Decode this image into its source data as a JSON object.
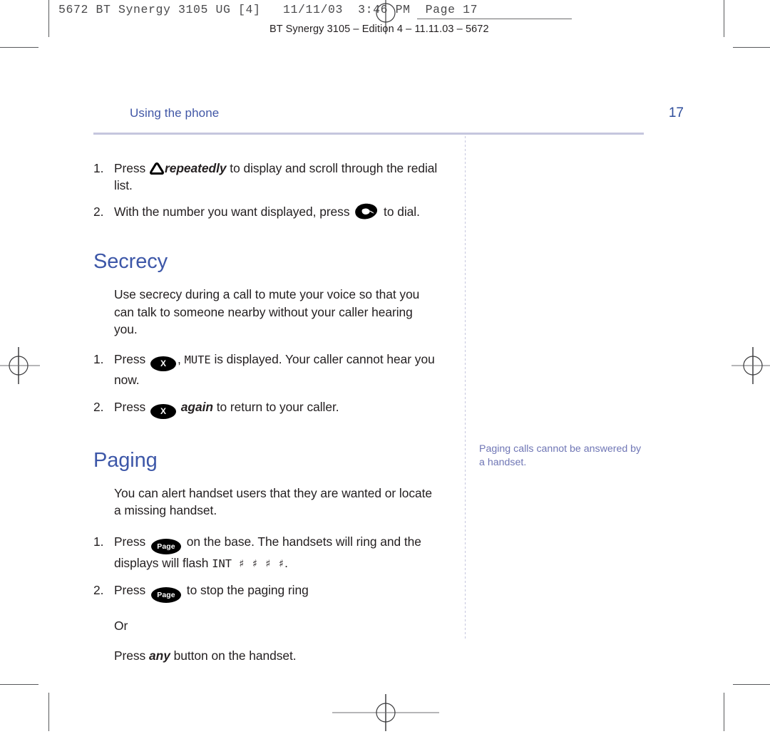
{
  "print_marks": {
    "slug_line": "5672 BT Synergy 3105 UG [4]   11/11/03  3:46 PM  Page 17",
    "registration_mark_name": "registration-mark"
  },
  "running_head": {
    "edition_line": "BT Synergy 3105 – Edition 4 – 11.11.03 – 5672"
  },
  "page_header": {
    "chapter_title": "Using the phone",
    "folio": "17",
    "rule_color": "#c5c6de",
    "title_color": "#4157a6",
    "folio_color": "#2e4d9b"
  },
  "redial_steps": [
    {
      "num": "1.",
      "before_icon": "Press ",
      "icon": "scroll-up-triangle-icon",
      "emphasis": "repeatedly",
      "after": " to display and scroll through the redial list."
    },
    {
      "num": "2.",
      "before_icon": "With the number you want displayed, press ",
      "icon": "dial-handset-icon",
      "after": " to dial."
    }
  ],
  "sections": [
    {
      "heading": "Secrecy",
      "intro": "Use secrecy during a call to mute your voice so that you can talk to someone nearby without your caller hearing you.",
      "steps": [
        {
          "num": "1.",
          "before_key": "Press ",
          "key_label": "X",
          "lcd_separator": ", ",
          "lcd_text": "MUTE",
          "after": " is displayed. Your caller cannot hear you now."
        },
        {
          "num": "2.",
          "before_key": "Press ",
          "key_label": "X",
          "emphasis": "again",
          "after": " to return to your caller."
        }
      ]
    },
    {
      "heading": "Paging",
      "intro": "You can alert handset users that they are wanted or locate a missing handset.",
      "steps": [
        {
          "num": "1.",
          "before_key": "Press ",
          "key_label": "Page",
          "after": " on the base. The handsets will ring and the displays will flash ",
          "lcd_text": "INT ♯ ♯ ♯ ♯",
          "tail": "."
        },
        {
          "num": "2.",
          "before_key": "Press ",
          "key_label": "Page",
          "after": " to stop the paging ring"
        }
      ],
      "alternative": {
        "or_label": "Or",
        "before_emphasis": "Press ",
        "emphasis": "any",
        "after": " button on the handset."
      }
    }
  ],
  "margin_note": {
    "text": "Paging calls cannot be answered by a handset.",
    "color": "#6f76b5"
  }
}
